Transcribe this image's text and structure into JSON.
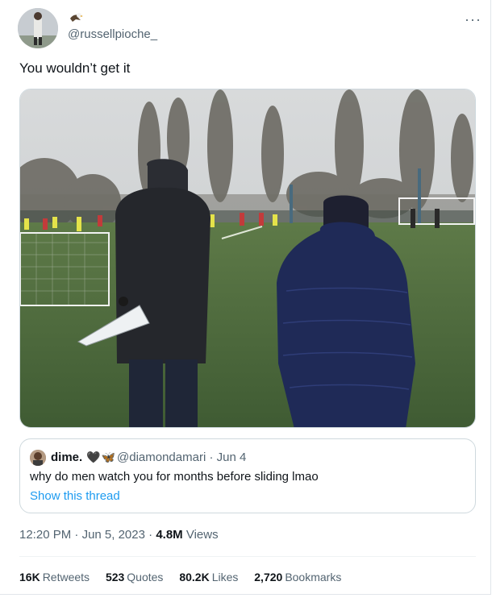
{
  "tweet": {
    "handle": "@russellpioche_",
    "name_emoji": "eagle-emoji",
    "text": "You wouldn’t get it",
    "more": "···",
    "time": "12:20 PM",
    "date": "Jun 5, 2023",
    "views": {
      "count": "4.8M",
      "label": "Views"
    },
    "separator": "·"
  },
  "quote": {
    "name": "dime.",
    "emoji": {
      "heart": "🖤",
      "butterfly": "🦋"
    },
    "handle": "@diamondamari",
    "date": "Jun 4",
    "text": "why do men watch you for months before sliding lmao",
    "link": "Show this thread"
  },
  "stats": [
    {
      "count": "16K",
      "label": "Retweets"
    },
    {
      "count": "523",
      "label": "Quotes"
    },
    {
      "count": "80.2K",
      "label": "Likes"
    },
    {
      "count": "2,720",
      "label": "Bookmarks"
    }
  ],
  "media": {
    "description_icon": "photo-two-men-watching-football-training"
  },
  "colors": {
    "accent": "#1d9bf0",
    "muted": "#536471",
    "text": "#0f1419",
    "border": "#cfd9de"
  }
}
